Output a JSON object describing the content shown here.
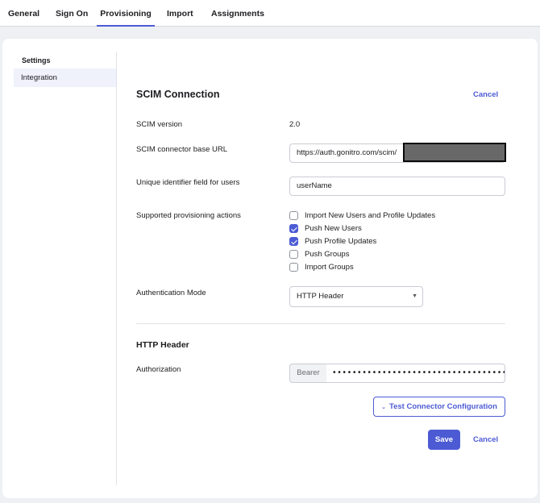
{
  "tabs": [
    {
      "label": "General"
    },
    {
      "label": "Sign On"
    },
    {
      "label": "Provisioning",
      "active": true
    },
    {
      "label": "Import"
    },
    {
      "label": "Assignments"
    }
  ],
  "sidebar": {
    "heading": "Settings",
    "items": [
      {
        "label": "Integration",
        "selected": true
      }
    ]
  },
  "scim": {
    "title": "SCIM Connection",
    "cancel_top": "Cancel",
    "version_label": "SCIM version",
    "version_value": "2.0",
    "base_url_label": "SCIM connector base URL",
    "base_url_value": "https://auth.gonitro.com/scim/",
    "uid_label": "Unique identifier field for users",
    "uid_value": "userName",
    "actions_label": "Supported provisioning actions",
    "actions": [
      {
        "label": "Import New Users and Profile Updates",
        "checked": false
      },
      {
        "label": "Push New Users",
        "checked": true
      },
      {
        "label": "Push Profile Updates",
        "checked": true
      },
      {
        "label": "Push Groups",
        "checked": false
      },
      {
        "label": "Import Groups",
        "checked": false
      }
    ],
    "auth_mode_label": "Authentication Mode",
    "auth_mode_value": "HTTP Header"
  },
  "http_header": {
    "title": "HTTP Header",
    "authorization_label": "Authorization",
    "prefix": "Bearer",
    "token_masked": "••••••••••••••••••••••••••••••••••••••••"
  },
  "buttons": {
    "test_connector": "Test Connector Configuration",
    "save": "Save",
    "cancel": "Cancel"
  },
  "colors": {
    "accent": "#4c5bd4",
    "sidebar_selected_bg": "#eff1fb"
  }
}
